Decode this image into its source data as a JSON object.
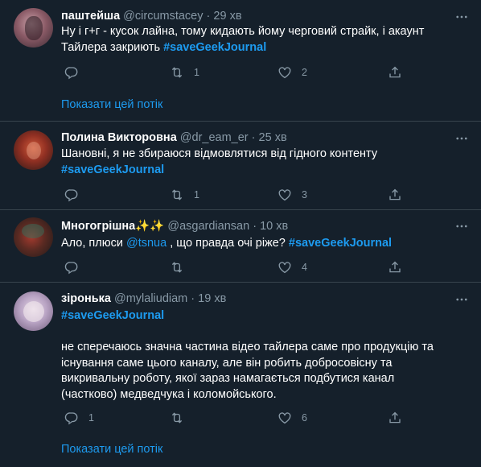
{
  "tweets": [
    {
      "name": "паштейша",
      "handle": "@circumstacey",
      "sep": "·",
      "time": "29 хв",
      "text_plain": "Ну і г+г - кусок лайна, тому кидають йому черговий страйк, і акаунт Тайлера закриють ",
      "hashtag": "#saveGeekJournal",
      "reply_count": "",
      "retweet_count": "1",
      "like_count": "2",
      "thread_link": "Показати цей потік"
    },
    {
      "name": "Полина Викторовна",
      "handle": "@dr_eam_er",
      "sep": "·",
      "time": "25 хв",
      "text_plain": "Шановні, я не збираюся відмовлятися від гідного контенту",
      "hashtag": "#saveGeekJournal",
      "reply_count": "",
      "retweet_count": "1",
      "like_count": "3"
    },
    {
      "name": "Многогрішна",
      "name_emoji": "✨✨",
      "handle": "@asgardiansan",
      "sep": "·",
      "time": "10 хв",
      "text_before": "Ало, плюси ",
      "mention": "@tsnua",
      "text_after": " , що правда очі ріже? ",
      "hashtag": "#saveGeekJournal",
      "reply_count": "",
      "retweet_count": "",
      "like_count": "4"
    },
    {
      "name": "зіронька",
      "handle": "@mylaliudiam",
      "sep": "·",
      "time": "19 хв",
      "hashtag": "#saveGeekJournal",
      "text_para": "не сперечаюсь значна частина відео тайлера саме про продукцію та існування саме цього каналу, але він робить добросовісну та викривальну роботу, якої зараз намагається подбутися канал (частково) медведчука і коломойського.",
      "reply_count": "1",
      "retweet_count": "",
      "like_count": "6",
      "thread_link": "Показати цей потік"
    }
  ],
  "icons": {
    "more": "more-dots-icon",
    "reply": "reply-icon",
    "retweet": "retweet-icon",
    "like": "heart-icon",
    "share": "share-icon"
  },
  "colors": {
    "background": "#15202b",
    "accent": "#1d9bf0",
    "secondary_text": "#8899a6",
    "divider": "#38444d"
  }
}
